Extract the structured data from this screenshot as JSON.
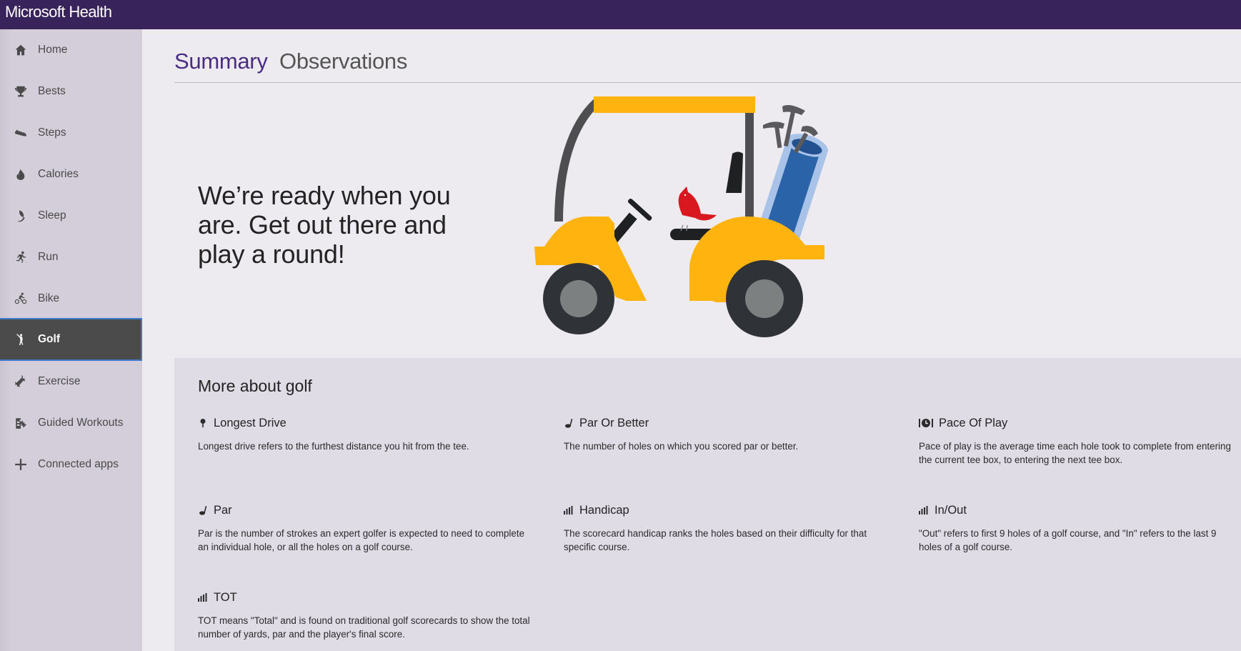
{
  "app": {
    "title": "Microsoft Health"
  },
  "sidebar": {
    "active": "Golf",
    "items": [
      {
        "label": "Home",
        "icon": "home-icon"
      },
      {
        "label": "Bests",
        "icon": "trophy-icon"
      },
      {
        "label": "Steps",
        "icon": "shoe-icon"
      },
      {
        "label": "Calories",
        "icon": "flame-icon"
      },
      {
        "label": "Sleep",
        "icon": "moon-icon"
      },
      {
        "label": "Run",
        "icon": "runner-icon"
      },
      {
        "label": "Bike",
        "icon": "cyclist-icon"
      },
      {
        "label": "Golf",
        "icon": "golfer-icon"
      },
      {
        "label": "Exercise",
        "icon": "dumbbell-icon"
      },
      {
        "label": "Guided Workouts",
        "icon": "guided-workout-icon"
      },
      {
        "label": "Connected apps",
        "icon": "plus-icon"
      }
    ]
  },
  "tabs": [
    {
      "label": "Summary",
      "active": true
    },
    {
      "label": "Observations",
      "active": false
    }
  ],
  "hero": {
    "message": "We’re ready when you are. Get out there and play a round!",
    "illustration": "golf-cart-illustration"
  },
  "info": {
    "title": "More about golf",
    "terms": [
      {
        "name": "Longest Drive",
        "icon": "golf-tee-icon",
        "description": "Longest drive refers to the furthest distance you hit from the tee."
      },
      {
        "name": "Par Or Better",
        "icon": "golf-club-icon",
        "description": "The number of holes on which you scored par or better."
      },
      {
        "name": "Pace Of Play",
        "icon": "clock-icon",
        "description": "Pace of play is the average time each hole took to complete from entering the current tee box, to entering the next tee box."
      },
      {
        "name": "Par",
        "icon": "golf-club-icon",
        "description": "Par is the number of strokes an expert golfer is expected to need to complete an individual hole, or all the holes on a golf course."
      },
      {
        "name": "Handicap",
        "icon": "bar-chart-icon",
        "description": "The scorecard handicap ranks the holes based on their difficulty for that specific course."
      },
      {
        "name": "In/Out",
        "icon": "bar-chart-icon",
        "description": "\"Out\" refers to first 9 holes of a golf course, and \"In\" refers to the last 9 holes of a golf course."
      },
      {
        "name": "TOT",
        "icon": "bar-chart-icon",
        "description": "TOT means \"Total\" and is found on traditional golf scorecards to show the total number of yards, par and the player's final score."
      }
    ]
  },
  "colors": {
    "header": "#38245a",
    "accent": "#4a2d82",
    "active_nav": "#4b4b4b",
    "active_nav_border": "#3d7ac8",
    "cart_yellow": "#ffb30f",
    "cart_dark": "#2f3236",
    "bag_blue": "#2a63a8",
    "cardinal_red": "#d9171e"
  }
}
